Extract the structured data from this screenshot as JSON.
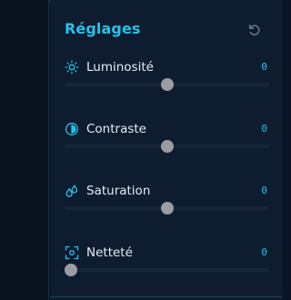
{
  "panel": {
    "title": "Réglages",
    "reset_icon": "reset-icon"
  },
  "settings": [
    {
      "label": "Luminosité",
      "value": "0",
      "icon": "brightness-icon",
      "slider_fraction": 0.5
    },
    {
      "label": "Contraste",
      "value": "0",
      "icon": "contrast-icon",
      "slider_fraction": 0.5
    },
    {
      "label": "Saturation",
      "value": "0",
      "icon": "saturation-icon",
      "slider_fraction": 0.5
    },
    {
      "label": "Netteté",
      "value": "0",
      "icon": "sharpness-icon",
      "slider_fraction": 0.0
    }
  ],
  "colors": {
    "accent": "#22c5e8",
    "panel_bg": "#0e1c30",
    "thumb": "#9a9ca1",
    "track": "#17243a"
  }
}
